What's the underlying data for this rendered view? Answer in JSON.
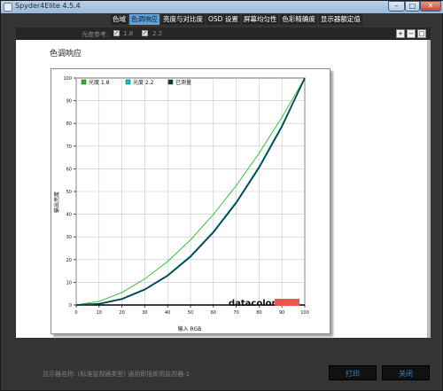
{
  "window": {
    "title": "Spyder4Elite 4.5.4"
  },
  "window_controls": {
    "minimize": "–",
    "maximize": "□",
    "close": "✕"
  },
  "tabs": [
    {
      "label": "色域"
    },
    {
      "label": "色调响应",
      "active": true
    },
    {
      "label": "亮度与对比度"
    },
    {
      "label": "OSD 设置"
    },
    {
      "label": "屏幕均匀性"
    },
    {
      "label": "色彩精确度"
    },
    {
      "label": "显示器额定值"
    }
  ],
  "toolbar": {
    "gamma_label": "光度参考:",
    "gamma_options": [
      {
        "value": "1.8",
        "checked": true
      },
      {
        "value": "2.2",
        "checked": true
      }
    ],
    "zoom_buttons": [
      {
        "icon": "zoom-in-icon"
      },
      {
        "icon": "zoom-out-icon"
      },
      {
        "icon": "zoom-fit-icon"
      }
    ]
  },
  "page": {
    "title": "色调响应"
  },
  "chart_data": {
    "type": "line",
    "xlabel": "输入 RGB",
    "ylabel": "输出亮度",
    "xlim": [
      0,
      100
    ],
    "ylim": [
      0,
      100
    ],
    "xticks": [
      0,
      10,
      20,
      30,
      40,
      50,
      60,
      70,
      80,
      90,
      100
    ],
    "yticks": [
      0,
      10,
      20,
      30,
      40,
      50,
      60,
      70,
      80,
      90,
      100
    ],
    "grid": true,
    "legend_position": "top-left",
    "series": [
      {
        "name": "光度 1.8",
        "color": "#22c022",
        "x": [
          0,
          10,
          20,
          30,
          40,
          50,
          60,
          70,
          80,
          90,
          100
        ],
        "y": [
          0,
          1.6,
          5.5,
          11.5,
          19.2,
          28.7,
          39.9,
          52.6,
          66.9,
          82.7,
          100
        ]
      },
      {
        "name": "光度 2.2",
        "color": "#00cccc",
        "x": [
          0,
          10,
          20,
          30,
          40,
          50,
          60,
          70,
          80,
          90,
          100
        ],
        "y": [
          0,
          0.6,
          2.9,
          7.1,
          13.3,
          21.8,
          32.5,
          45.6,
          61.2,
          79.3,
          100
        ]
      },
      {
        "name": "已测量",
        "color": "#0a3c4a",
        "x": [
          0,
          10,
          20,
          30,
          40,
          50,
          60,
          70,
          80,
          90,
          100
        ],
        "y": [
          0,
          0.5,
          2.6,
          6.8,
          12.9,
          21.3,
          32.0,
          45.0,
          60.5,
          78.6,
          100
        ]
      }
    ],
    "watermark": "datacolor"
  },
  "footer": {
    "info": "显示器名称: (标准监视器类型) 通用即插即用监视器-1",
    "print_label": "打印",
    "close_label": "关闭"
  }
}
